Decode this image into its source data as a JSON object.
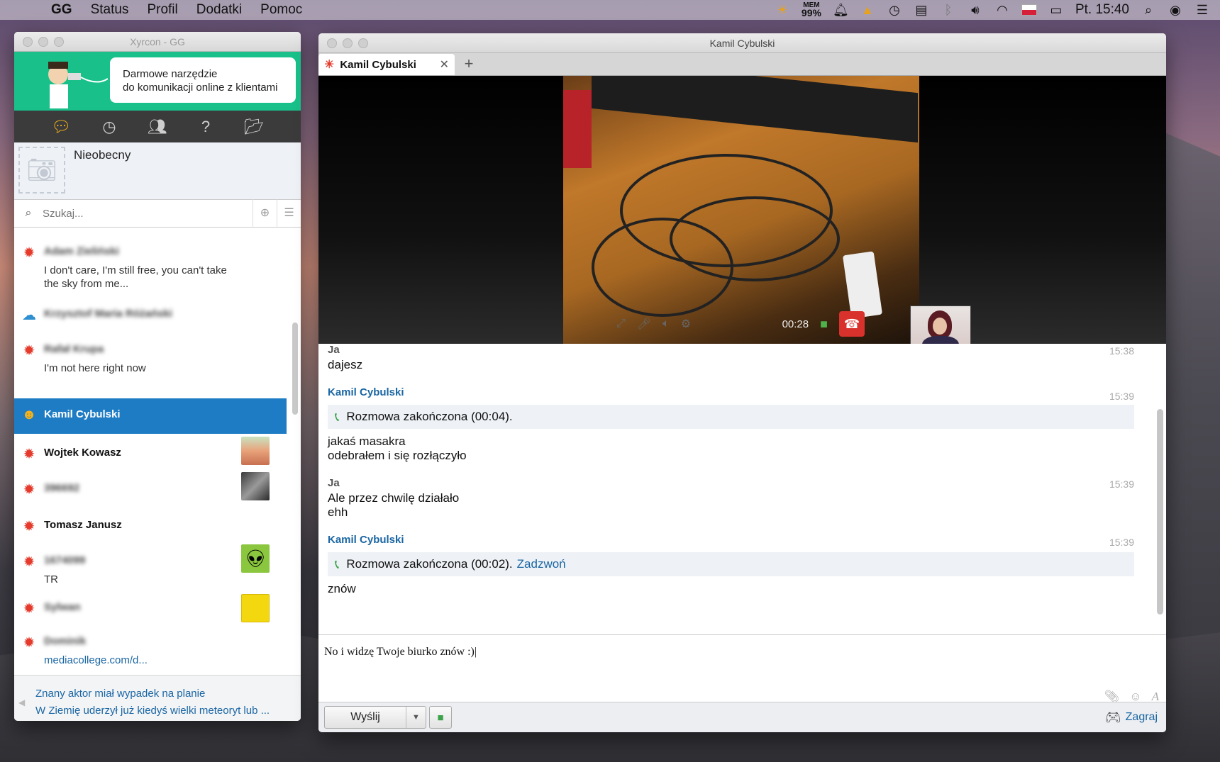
{
  "menubar": {
    "app": "GG",
    "items": [
      "Status",
      "Profil",
      "Dodatki",
      "Pomoc"
    ],
    "mem_label": "MEM",
    "mem_value": "99%",
    "clock": "Pt. 15:40"
  },
  "contacts_window": {
    "title": "Xyrcon - GG",
    "banner_line1": "Darmowe narzędzie",
    "banner_line2": "do komunikacji online z klientami",
    "profile_status": "Nieobecny",
    "search_placeholder": "Szukaj...",
    "contacts": [
      {
        "name": "Adam Zieliński",
        "blurred": true,
        "desc": "I don't care, I'm still free, you can't take the sky from me...",
        "status_color": "#e53b2c",
        "avatar": null
      },
      {
        "name": "Krzysztof Maria Różański",
        "blurred": true,
        "desc": "",
        "status_color": "#f3a21a",
        "avatar": null
      },
      {
        "name": "Rafał Krupa",
        "blurred": true,
        "desc": "I'm not here right now",
        "status_color": "#e53b2c",
        "avatar": null
      },
      {
        "name": "Kamil Cybulski",
        "blurred": false,
        "desc": "",
        "status_color": "#f3b21a",
        "selected": true,
        "avatar": null
      },
      {
        "name": "Wojtek Kowasz",
        "blurred": false,
        "desc": "",
        "status_color": "#e53b2c",
        "avatar": "#e8a27a"
      },
      {
        "name": "396692",
        "blurred": true,
        "desc": "",
        "status_color": "#e53b2c",
        "avatar": "#6b6b6b"
      },
      {
        "name": "Tomasz Janusz",
        "blurred": false,
        "desc": "",
        "status_color": "#e53b2c",
        "avatar": null
      },
      {
        "name": "1674099",
        "blurred": true,
        "desc": "TR",
        "status_color": "#e53b2c",
        "avatar": "#8bc63f"
      },
      {
        "name": "Sylwan",
        "blurred": true,
        "desc": "",
        "status_color": "#e53b2c",
        "avatar": "#f4d80f"
      },
      {
        "name": "Dominik",
        "blurred": true,
        "desc": "mediacollege.com/d...",
        "desc_link": true,
        "status_color": "#e53b2c",
        "avatar": null
      }
    ],
    "news": [
      "Znany aktor miał wypadek na planie",
      "W Ziemię uderzył już kiedyś wielki meteoryt  lub ..."
    ]
  },
  "chat_window": {
    "title": "Kamil Cybulski",
    "tab_label": "Kamil Cybulski",
    "call_time": "00:28",
    "messages": [
      {
        "author": "Ja",
        "them": false,
        "time": "15:38",
        "lines": [
          "dajesz"
        ]
      },
      {
        "author": "Kamil Cybulski",
        "them": true,
        "time": "15:39",
        "call": "Rozmowa zakończona (00:04).",
        "call_link": "",
        "lines": [
          "jakaś masakra",
          "odebrałem i się rozłączyło"
        ]
      },
      {
        "author": "Ja",
        "them": false,
        "time": "15:39",
        "lines": [
          "Ale przez chwilę działało",
          "ehh"
        ]
      },
      {
        "author": "Kamil Cybulski",
        "them": true,
        "time": "15:39",
        "call": "Rozmowa zakończona (00:02).",
        "call_link": "Zadzwoń",
        "lines": [
          "znów"
        ]
      }
    ],
    "compose_text": "No i widzę Twoje biurko znów :)",
    "send_label": "Wyślij",
    "play_label": "Zagraj"
  }
}
